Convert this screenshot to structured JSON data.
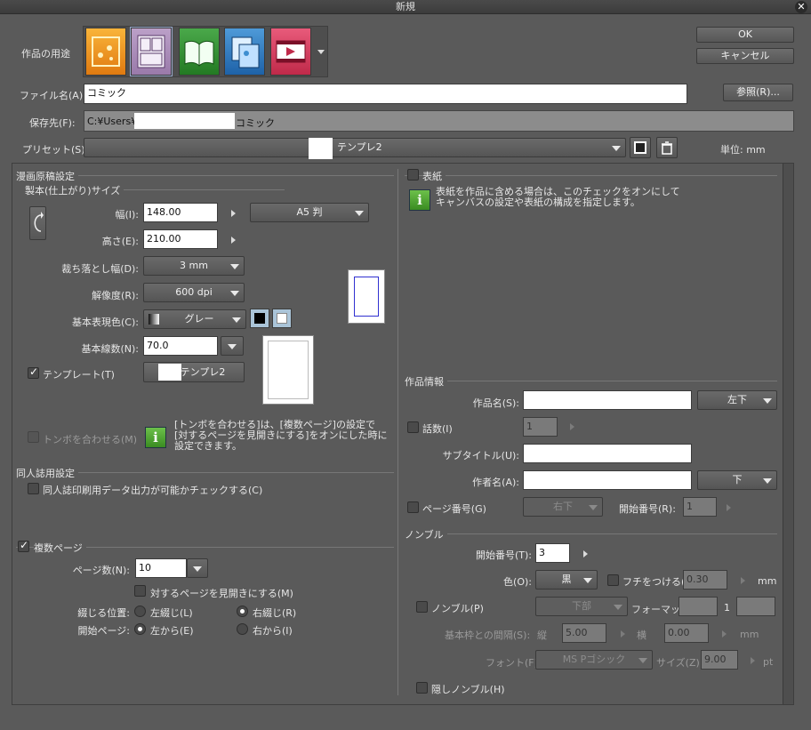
{
  "window": {
    "title": "新規",
    "close": "✕"
  },
  "buttons": {
    "ok": "OK",
    "cancel": "キャンセル",
    "browse": "参照(R)..."
  },
  "purpose": {
    "label": "作品の用途"
  },
  "file": {
    "name_label": "ファイル名(A):",
    "name_value": "コミック",
    "dest_label": "保存先(F):",
    "dest_prefix": "C:¥Users¥",
    "dest_suffix": "コミック"
  },
  "preset": {
    "label": "プリセット(S):",
    "value": "テンプレ2",
    "unit_label": "単位:",
    "unit_value": "mm"
  },
  "manga": {
    "section": "漫画原稿設定",
    "sub": "製本(仕上がり)サイズ",
    "width_label": "幅(I):",
    "width_value": "148.00",
    "height_label": "高さ(E):",
    "height_value": "210.00",
    "size_preset": "A5 判",
    "bleed_label": "裁ち落とし幅(D):",
    "bleed_value": "3 mm",
    "res_label": "解像度(R):",
    "res_value": "600 dpi",
    "color_label": "基本表現色(C):",
    "color_value": "グレー",
    "lpi_label": "基本線数(N):",
    "lpi_value": "70.0",
    "template_label": "テンプレート(T)",
    "template_value": "テンプレ2",
    "tombo_label": "トンボを合わせる(M)",
    "tombo_info": [
      "[トンボを合わせる]は、[複数ページ]の設定で",
      "[対するページを見開きにする]をオンにした時に",
      "設定できます。"
    ]
  },
  "doujin": {
    "section": "同人誌用設定",
    "check": "同人誌印刷用データ出力が可能かチェックする(C)"
  },
  "multi": {
    "label": "複数ページ",
    "pages_label": "ページ数(N):",
    "pages_value": "10",
    "spread": "対するページを見開きにする(M)",
    "bind_label": "綴じる位置:",
    "bind_left": "左綴じ(L)",
    "bind_right": "右綴じ(R)",
    "start_label": "開始ページ:",
    "start_left": "左から(E)",
    "start_right": "右から(I)"
  },
  "cover": {
    "label": "表紙",
    "info": [
      "表紙を作品に含める場合は、このチェックをオンにして",
      "キャンバスの設定や表紙の構成を指定します。"
    ]
  },
  "work": {
    "section": "作品情報",
    "title_label": "作品名(S):",
    "title_pos": "左下",
    "episode_label": "話数(I)",
    "episode_value": "1",
    "subtitle_label": "サブタイトル(U):",
    "author_label": "作者名(A):",
    "author_pos": "下",
    "pagenum_label": "ページ番号(G)",
    "pagenum_pos": "右下",
    "startnum_label": "開始番号(R):",
    "startnum_value": "1"
  },
  "nombre": {
    "section": "ノンブル",
    "start_label": "開始番号(T):",
    "start_value": "3",
    "color_label": "色(O):",
    "color_value": "黒",
    "edge_label": "フチをつける(E)",
    "edge_value": "0.30",
    "edge_unit": "mm",
    "nombre_label": "ノンブル(P)",
    "pos_value": "下部",
    "format_label": "フォーマット",
    "format_mid": "1",
    "gap_label": "基本枠との間隔(S):",
    "v_label": "縦",
    "v_value": "5.00",
    "h_label": "横",
    "h_value": "0.00",
    "gap_unit": "mm",
    "font_label": "フォント(F):",
    "font_value": "MS Pゴシック",
    "size_label": "サイズ(Z):",
    "size_value": "9.00",
    "size_unit": "pt",
    "hidden_label": "隠しノンブル(H)"
  },
  "colors": {
    "accent": "#6cc04a",
    "bg": "#5a5a5a"
  }
}
